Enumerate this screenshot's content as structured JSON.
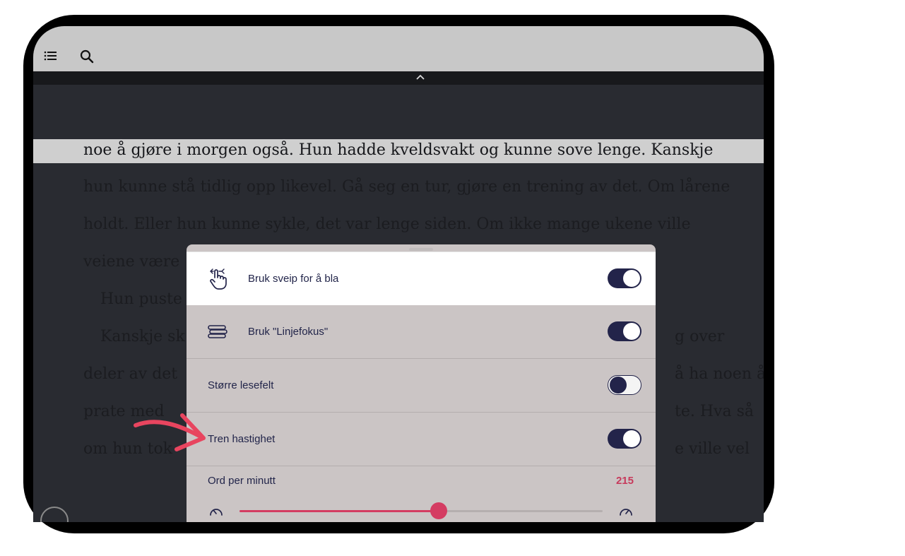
{
  "topbar": {
    "menu_icon": "list-icon",
    "search_icon": "search-icon"
  },
  "reader": {
    "highlighted_line": "noe å gjøre i morgen også. Hun hadde kveldsvakt og kunne sove lenge. Kanskje",
    "dim_lines": [
      "hun kunne stå tidlig opp likevel. Gå seg en tur, gjøre en trening av det. Om lårene",
      "holdt. Eller hun kunne sykle, det var lenge siden. Om ikke mange ukene ville",
      "veiene være",
      "Hun puste",
      "Kanskje sk",
      "deler av det",
      "prate med",
      "om hun tok"
    ],
    "dim_right_lines": [
      "g over",
      "å ha noen å",
      "te. Hva så",
      "e ville vel"
    ]
  },
  "settings": {
    "rows": [
      {
        "label": "Bruk sveip for å bla",
        "icon": "swipe-hand-icon",
        "on": true
      },
      {
        "label": "Bruk \"Linjefokus\"",
        "icon": "line-focus-icon",
        "on": true
      },
      {
        "label": "Større lesefelt",
        "on": false
      },
      {
        "label": "Tren hastighet",
        "on": true
      }
    ],
    "wpm_label": "Ord per minutt",
    "wpm_value": "215",
    "slider_fraction": 0.549,
    "slow_icon": "slow-gauge-icon",
    "fast_icon": "fast-gauge-icon"
  },
  "colors": {
    "accent": "#d43c62",
    "toggle_on": "#23244a",
    "panel_bg": "#cbc5c5"
  }
}
